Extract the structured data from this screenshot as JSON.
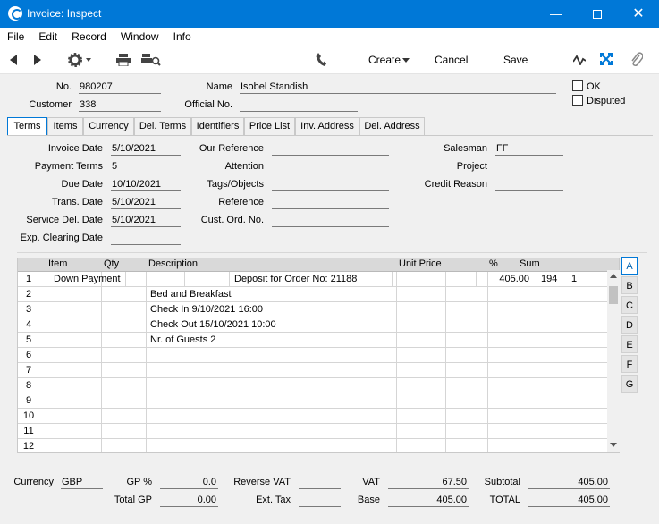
{
  "window": {
    "title": "Invoice: Inspect"
  },
  "menu": [
    "File",
    "Edit",
    "Record",
    "Window",
    "Info"
  ],
  "toolbar": {
    "create": "Create",
    "cancel": "Cancel",
    "save": "Save"
  },
  "header": {
    "no_label": "No.",
    "no": "980207",
    "name_label": "Name",
    "name": "Isobel Standish",
    "customer_label": "Customer",
    "customer": "338",
    "official_label": "Official No.",
    "official": "",
    "ok_label": "OK",
    "disputed_label": "Disputed"
  },
  "tabs": [
    "Terms",
    "Items",
    "Currency",
    "Del. Terms",
    "Identifiers",
    "Price List",
    "Inv. Address",
    "Del. Address"
  ],
  "terms": {
    "invoice_date_label": "Invoice Date",
    "invoice_date": "5/10/2021",
    "payment_terms_label": "Payment Terms",
    "payment_terms": "5",
    "due_date_label": "Due Date",
    "due_date": "10/10/2021",
    "trans_date_label": "Trans. Date",
    "trans_date": "5/10/2021",
    "service_date_label": "Service Del. Date",
    "service_date": "5/10/2021",
    "exp_clearing_label": "Exp. Clearing Date",
    "exp_clearing": "",
    "our_ref_label": "Our Reference",
    "attention_label": "Attention",
    "tags_label": "Tags/Objects",
    "reference_label": "Reference",
    "cust_ord_label": "Cust. Ord. No.",
    "salesman_label": "Salesman",
    "salesman": "FF",
    "project_label": "Project",
    "credit_reason_label": "Credit Reason"
  },
  "grid": {
    "columns": [
      "Item",
      "Qty",
      "Description",
      "Unit Price",
      "%",
      "Sum"
    ],
    "row1": {
      "no": "1",
      "item": "Down Payment",
      "desc": "Deposit for Order No: 21188",
      "sum": "405.00",
      "c1": "194",
      "c2": "1"
    },
    "rows": [
      {
        "no": "2",
        "desc": "Bed and Breakfast"
      },
      {
        "no": "3",
        "desc": "Check In 9/10/2021  16:00"
      },
      {
        "no": "4",
        "desc": "Check Out 15/10/2021  10:00"
      },
      {
        "no": "5",
        "desc": "Nr. of Guests 2"
      },
      {
        "no": "6",
        "desc": ""
      },
      {
        "no": "7",
        "desc": ""
      },
      {
        "no": "8",
        "desc": ""
      },
      {
        "no": "9",
        "desc": ""
      },
      {
        "no": "10",
        "desc": ""
      },
      {
        "no": "11",
        "desc": ""
      },
      {
        "no": "12",
        "desc": ""
      }
    ]
  },
  "side_tabs": [
    "A",
    "B",
    "C",
    "D",
    "E",
    "F",
    "G"
  ],
  "footer": {
    "currency_label": "Currency",
    "currency": "GBP",
    "gp_pct_label": "GP %",
    "gp_pct": "0.0",
    "total_gp_label": "Total GP",
    "total_gp": "0.00",
    "reverse_vat_label": "Reverse VAT",
    "ext_tax_label": "Ext. Tax",
    "vat_label": "VAT",
    "vat": "67.50",
    "base_label": "Base",
    "base": "405.00",
    "subtotal_label": "Subtotal",
    "subtotal": "405.00",
    "total_label": "TOTAL",
    "total": "405.00"
  }
}
